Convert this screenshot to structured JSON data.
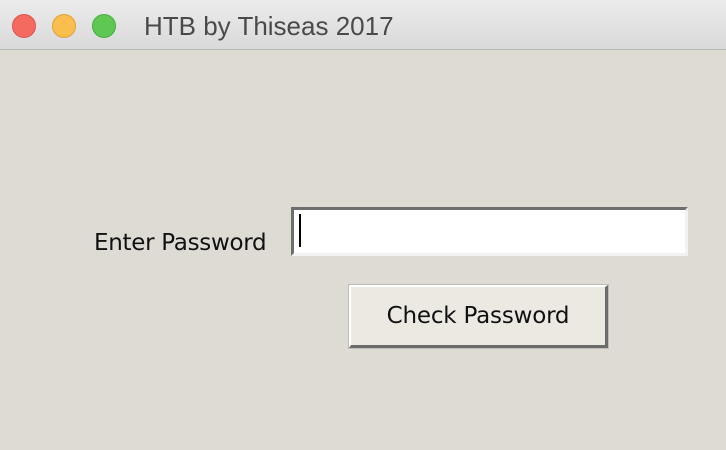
{
  "window": {
    "title": "HTB by Thiseas 2017",
    "controls": [
      "close",
      "minimize",
      "zoom"
    ]
  },
  "form": {
    "password_label": "Enter Password",
    "password_value": "",
    "check_button_label": "Check Password"
  },
  "colors": {
    "background": "#dedbd5",
    "close": "#f46a61",
    "minimize": "#f9be4d",
    "zoom": "#5ec852",
    "field_background": "#ffffff"
  }
}
